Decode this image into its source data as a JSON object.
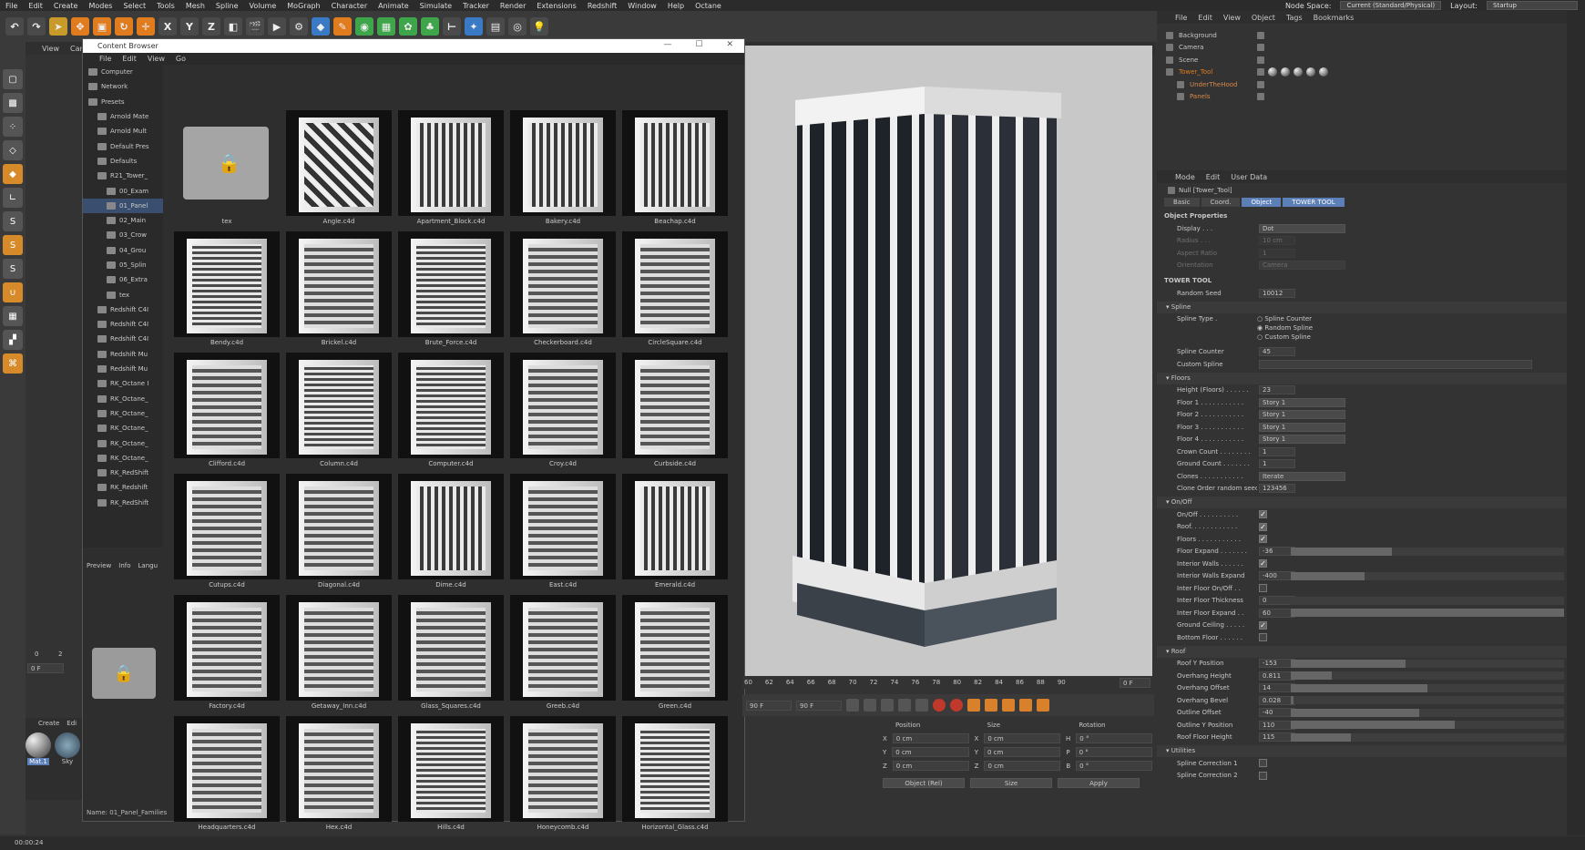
{
  "menubar": {
    "items": [
      "File",
      "Edit",
      "Create",
      "Modes",
      "Select",
      "Tools",
      "Mesh",
      "Spline",
      "Volume",
      "MoGraph",
      "Character",
      "Animate",
      "Simulate",
      "Tracker",
      "Render",
      "Extensions",
      "Redshift",
      "Window",
      "Help",
      "Octane"
    ],
    "node_space_label": "Node Space:",
    "node_space_value": "Current (Standard/Physical)",
    "layout_label": "Layout:",
    "layout_value": "Startup"
  },
  "toolbar": {
    "axis_x": "X",
    "axis_y": "Y",
    "axis_z": "Z"
  },
  "viewport_menu": {
    "view": "View",
    "cam": "Cam"
  },
  "content_browser": {
    "title": "Content Browser",
    "menu": [
      "File",
      "Edit",
      "View",
      "Go"
    ],
    "tree": [
      "Computer",
      "Network",
      "Presets",
      "Arnold Mate",
      "Arnold Mult",
      "Default Pres",
      "Defaults",
      "R21_Tower_",
      "00_Exam",
      "01_Panel",
      "02_Main",
      "03_Crow",
      "04_Grou",
      "05_Splin",
      "06_Extra",
      "tex",
      "Redshift C4I",
      "Redshift C4I",
      "Redshift C4I",
      "Redshift Mu",
      "Redshift Mu",
      "RK_Octane I",
      "RK_Octane_",
      "RK_Octane_",
      "RK_Octane_",
      "RK_Octane_",
      "RK_Octane_",
      "RK_RedShift",
      "RK_Redshift",
      "RK_RedShift"
    ],
    "preview_tabs": [
      "Preview",
      "Info",
      "Langu"
    ],
    "name_label": "Name: 01_Panel_Families",
    "items": [
      {
        "label": "tex",
        "style": "folder"
      },
      {
        "label": "Angle.c4d",
        "style": "d"
      },
      {
        "label": "Apartment_Block.c4d",
        "style": "v"
      },
      {
        "label": "Bakery.c4d",
        "style": "v"
      },
      {
        "label": "Beachap.c4d",
        "style": "v"
      },
      {
        "label": "Bendy.c4d",
        "style": "h"
      },
      {
        "label": "Brickel.c4d",
        "style": "c"
      },
      {
        "label": "Brute_Force.c4d",
        "style": "h"
      },
      {
        "label": "Checkerboard.c4d",
        "style": "c"
      },
      {
        "label": "CircleSquare.c4d",
        "style": "c"
      },
      {
        "label": "Clifford.c4d",
        "style": "c"
      },
      {
        "label": "Column.c4d",
        "style": "h"
      },
      {
        "label": "Computer.c4d",
        "style": "h"
      },
      {
        "label": "Croy.c4d",
        "style": "c"
      },
      {
        "label": "Curbside.c4d",
        "style": "c"
      },
      {
        "label": "Cutups.c4d",
        "style": "c"
      },
      {
        "label": "Diagonal.c4d",
        "style": "c"
      },
      {
        "label": "Dime.c4d",
        "style": "v"
      },
      {
        "label": "East.c4d",
        "style": "c"
      },
      {
        "label": "Emerald.c4d",
        "style": "v"
      },
      {
        "label": "Factory.c4d",
        "style": "c"
      },
      {
        "label": "Getaway_Inn.c4d",
        "style": "c"
      },
      {
        "label": "Glass_Squares.c4d",
        "style": "c"
      },
      {
        "label": "Greeb.c4d",
        "style": "c"
      },
      {
        "label": "Green.c4d",
        "style": "c"
      },
      {
        "label": "Headquarters.c4d",
        "style": "c"
      },
      {
        "label": "Hex.c4d",
        "style": "c"
      },
      {
        "label": "Hills.c4d",
        "style": "h"
      },
      {
        "label": "Honeycomb.c4d",
        "style": "c"
      },
      {
        "label": "Horizontal_Glass.c4d",
        "style": "h"
      }
    ]
  },
  "timeline": {
    "ticks": [
      "60",
      "62",
      "64",
      "66",
      "68",
      "70",
      "72",
      "74",
      "76",
      "78",
      "80",
      "82",
      "84",
      "86",
      "88",
      "90"
    ],
    "frame": "0 F",
    "field_a": "90 F",
    "field_b": "90 F",
    "left_ticks": [
      "0",
      "2"
    ],
    "left_frame": "0 F"
  },
  "materials": {
    "menu": [
      "Create",
      "Edi"
    ],
    "items": [
      "Mat.1",
      "Sky"
    ]
  },
  "coordinates": {
    "headers": [
      "Position",
      "Size",
      "Rotation"
    ],
    "rows": [
      {
        "a": "X",
        "av": "0 cm",
        "b": "X",
        "bv": "0 cm",
        "c": "H",
        "cv": "0 °"
      },
      {
        "a": "Y",
        "av": "0 cm",
        "b": "Y",
        "bv": "0 cm",
        "c": "P",
        "cv": "0 °"
      },
      {
        "a": "Z",
        "av": "0 cm",
        "b": "Z",
        "bv": "0 cm",
        "c": "B",
        "cv": "0 °"
      }
    ],
    "mode": "Object (Rel)",
    "size_mode": "Size",
    "apply": "Apply"
  },
  "status": "00:00:24",
  "object_manager": {
    "menu": [
      "File",
      "Edit",
      "View",
      "Object",
      "Tags",
      "Bookmarks"
    ],
    "objects": [
      "Background",
      "Camera",
      "Scene",
      "Tower_Tool",
      "UnderTheHood",
      "Panels"
    ]
  },
  "attributes": {
    "menu": [
      "Mode",
      "Edit",
      "User Data"
    ],
    "object_name": "Null [Tower_Tool]",
    "tabs": [
      "Basic",
      "Coord.",
      "Object",
      "TOWER TOOL"
    ],
    "object_props": "Object Properties",
    "display_label": "Display . . .",
    "display_value": "Dot",
    "radius_label": "Radius . . .",
    "radius_value": "10 cm",
    "aspect_label": "Aspect Ratio",
    "aspect_value": "1",
    "orient_label": "Orientation",
    "orient_value": "Camera",
    "tower_tool": "TOWER TOOL",
    "seed_label": "Random Seed",
    "seed_value": "10012",
    "spline_group": "Spline",
    "spline_type_label": "Spline Type .",
    "spline_opts": [
      "Spline Counter",
      "Random Spline",
      "Custom Spline"
    ],
    "spline_counter_label": "Spline Counter",
    "spline_counter_value": "45",
    "custom_spline_label": "Custom Spline",
    "floors_group": "Floors",
    "floors": [
      {
        "l": "Height (Floors) . . . . . .",
        "v": "23",
        "t": "num"
      },
      {
        "l": "Floor 1 . . . . . . . . . . .",
        "v": "Story 1",
        "t": "dd"
      },
      {
        "l": "Floor 2 . . . . . . . . . . .",
        "v": "Story 1",
        "t": "dd"
      },
      {
        "l": "Floor 3 . . . . . . . . . . .",
        "v": "Story 1",
        "t": "dd"
      },
      {
        "l": "Floor 4 . . . . . . . . . . .",
        "v": "Story 1",
        "t": "dd"
      },
      {
        "l": "Crown Count . . . . . . . .",
        "v": "1",
        "t": "num"
      },
      {
        "l": "Ground Count . . . . . . .",
        "v": "1",
        "t": "num"
      },
      {
        "l": "Clones . . . . . . . . . . .",
        "v": "Iterate",
        "t": "dd"
      },
      {
        "l": "Clone Order random seed",
        "v": "123456",
        "t": "num"
      }
    ],
    "onoff_group": "On/Off",
    "onoff": [
      {
        "l": "On/Off . . . . . . . . . .",
        "t": "cb",
        "on": true
      },
      {
        "l": "Roof. . . . . . . . . . . .",
        "t": "cb",
        "on": true
      },
      {
        "l": "Floors . . . . . . . . . . .",
        "t": "cb",
        "on": true
      },
      {
        "l": "Floor Expand . . . . . . .",
        "v": "-36",
        "t": "sl",
        "f": 0.37
      },
      {
        "l": "Interior Walls . . . . . .",
        "t": "cb",
        "on": true
      },
      {
        "l": "Interior Walls Expand",
        "v": "-400",
        "t": "sl",
        "f": 0.27
      },
      {
        "l": "Inter Floor On/Off . .",
        "t": "cb",
        "on": false
      },
      {
        "l": "Inter Floor Thickness",
        "v": "0",
        "t": "sl",
        "f": 0.0
      },
      {
        "l": "Inter Floor Expand . .",
        "v": "60",
        "t": "sl",
        "f": 1.0
      },
      {
        "l": "Ground Ceiling . . . . .",
        "t": "cb",
        "on": true
      },
      {
        "l": "Bottom Floor . . . . . .",
        "t": "cb",
        "on": false
      }
    ],
    "roof_group": "Roof",
    "roof": [
      {
        "l": "Roof Y Position",
        "v": "-153",
        "f": 0.42
      },
      {
        "l": "Overhang Height",
        "v": "0.811",
        "f": 0.15
      },
      {
        "l": "Overhang Offset",
        "v": "14",
        "f": 0.5
      },
      {
        "l": "Overhang Bevel",
        "v": "0.028",
        "f": 0.01
      },
      {
        "l": "Outline Offset",
        "v": "-40",
        "f": 0.47
      },
      {
        "l": "Outline Y Position",
        "v": "110",
        "f": 0.6
      },
      {
        "l": "Roof Floor Height",
        "v": "115",
        "f": 0.22
      }
    ],
    "util_group": "Utilities",
    "utils": [
      "Spline Correction 1",
      "Spline Correction 2"
    ]
  },
  "colors": {
    "accent": "#5c7fb8",
    "orange": "#e07b1e"
  }
}
